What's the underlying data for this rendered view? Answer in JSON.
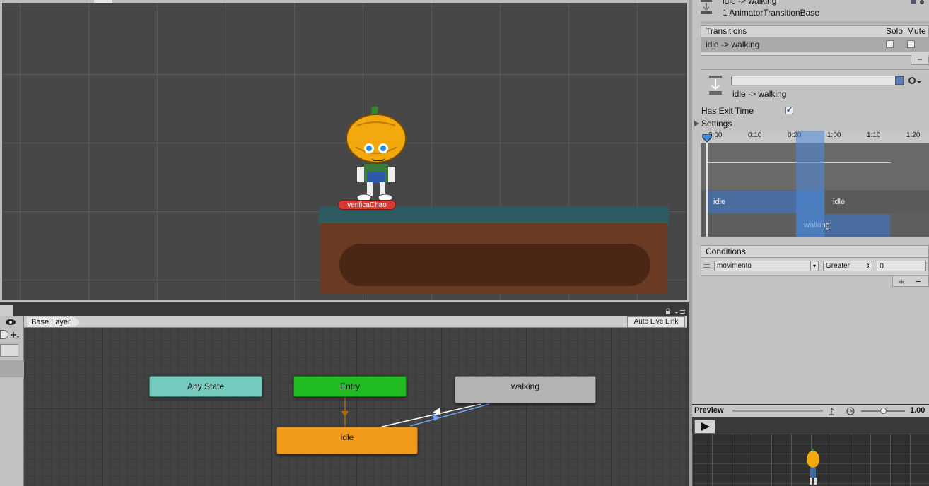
{
  "scene": {
    "character_label": "verificaChao"
  },
  "animator": {
    "breadcrumb": "Base Layer",
    "auto_live_link": "Auto Live Link",
    "states": {
      "any_state": "Any State",
      "entry": "Entry",
      "walking": "walking",
      "idle": "idle"
    },
    "colors": {
      "any_state": "#74cbbd",
      "entry": "#1fbd22",
      "walking": "#b3b3b3",
      "idle": "#f29a19",
      "selected_transition": "#6ea8ff"
    }
  },
  "inspector": {
    "header_title": "idle -> walking",
    "header_subtitle": "1 AnimatorTransitionBase",
    "transitions_label": "Transitions",
    "solo_label": "Solo",
    "mute_label": "Mute",
    "transition_row": "idle -> walking",
    "minus": "−",
    "name_field": "",
    "transition_name": "idle -> walking",
    "has_exit_time_label": "Has Exit Time",
    "has_exit_time": true,
    "settings_label": "Settings",
    "timeline": {
      "ticks": [
        "0:00",
        "0:10",
        "0:20",
        "1:00",
        "1:10",
        "1:20"
      ],
      "source_state": "idle",
      "source_state_repeat": "idle",
      "dest_state": "walking"
    },
    "conditions_label": "Conditions",
    "condition": {
      "parameter": "movimento",
      "operator": "Greater",
      "value": "0"
    },
    "plus": "+",
    "cond_minus": "−"
  },
  "preview": {
    "label": "Preview",
    "speed": "1.00"
  }
}
